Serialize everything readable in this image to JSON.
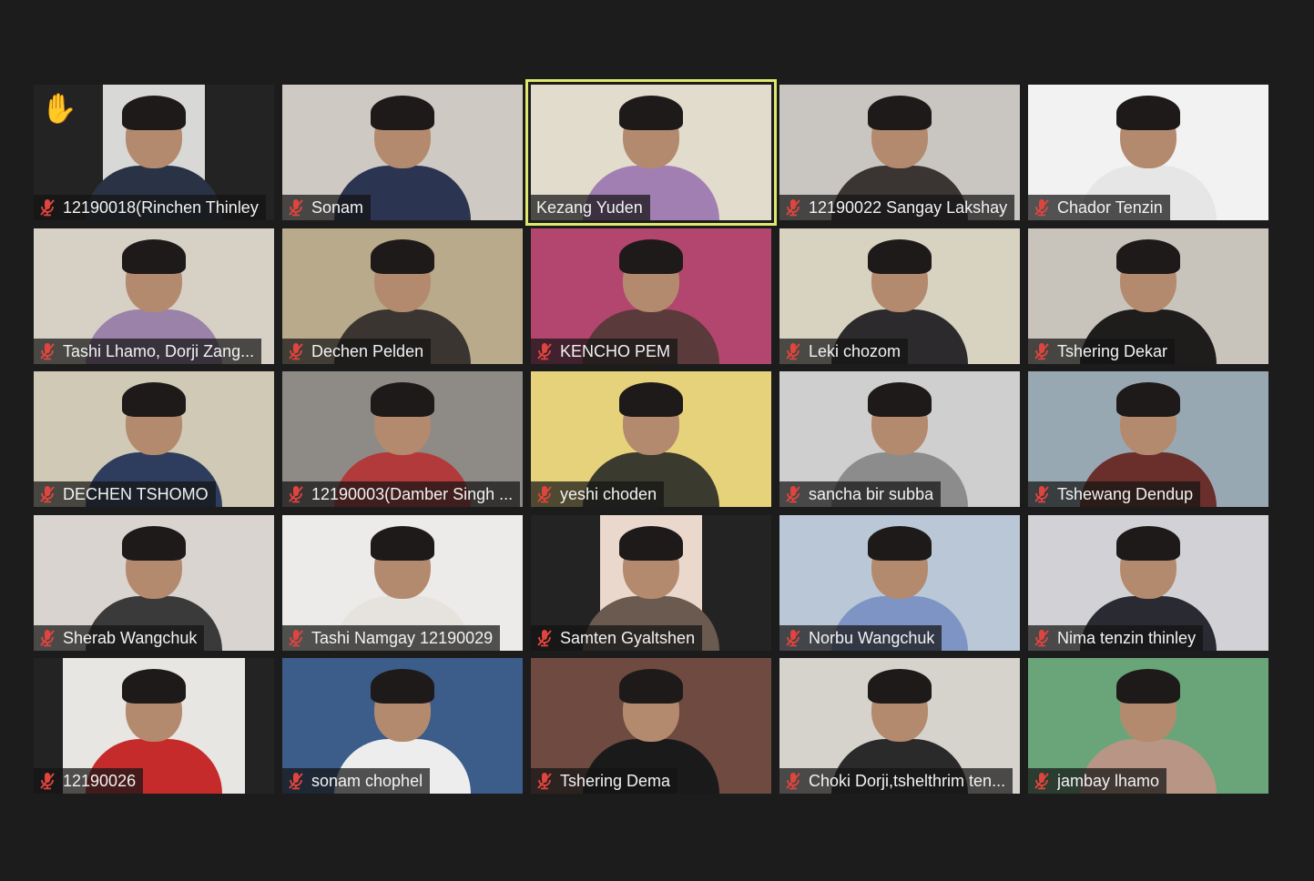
{
  "meeting": {
    "participants": [
      {
        "name": "12190018(Rinchen Thinley",
        "muted": true,
        "raised_hand": true,
        "bg": "#d8d8d6",
        "body": "#2a3346",
        "video": "narrow"
      },
      {
        "name": "Sonam",
        "muted": true,
        "bg": "#cfc9c4",
        "body": "#2b3552"
      },
      {
        "name": "Kezang Yuden",
        "muted": false,
        "active_speaker": true,
        "bg": "#e2dccd",
        "body": "#a27fb2"
      },
      {
        "name": "12190022 Sangay Lakshay",
        "muted": true,
        "bg": "#c9c6c2",
        "body": "#3a3432"
      },
      {
        "name": "Chador Tenzin",
        "muted": true,
        "bg": "#f2f2f2",
        "body": "#e6e6e6"
      },
      {
        "name": "Tashi Lhamo, Dorji Zang...",
        "muted": true,
        "bg": "#d6d0c5",
        "body": "#9a82a8"
      },
      {
        "name": "Dechen Pelden",
        "muted": true,
        "bg": "#b9aa8c",
        "body": "#3a3530"
      },
      {
        "name": "KENCHO PEM",
        "muted": true,
        "bg": "#b3466f",
        "body": "#5a3a3a"
      },
      {
        "name": "Leki chozom",
        "muted": true,
        "bg": "#d8d2c0",
        "body": "#2c2a2c"
      },
      {
        "name": "Tshering Dekar",
        "muted": true,
        "bg": "#c9c4bb",
        "body": "#1f1c1c"
      },
      {
        "name": "DECHEN TSHOMO",
        "muted": true,
        "bg": "#cfc9b5",
        "body": "#2e3d5e"
      },
      {
        "name": "12190003(Damber Singh ...",
        "muted": true,
        "bg": "#8e8a86",
        "body": "#b23a3a"
      },
      {
        "name": "yeshi choden",
        "muted": true,
        "bg": "#e6d27a",
        "body": "#3a3a2e"
      },
      {
        "name": "sancha bir subba",
        "muted": true,
        "bg": "#cfcfcf",
        "body": "#8c8c8c"
      },
      {
        "name": "Tshewang Dendup",
        "muted": true,
        "bg": "#98a8b3",
        "body": "#6a2f2a"
      },
      {
        "name": "Sherab Wangchuk",
        "muted": true,
        "bg": "#d9d4cf",
        "body": "#3a3a3a"
      },
      {
        "name": "Tashi Namgay 12190029",
        "muted": true,
        "bg": "#ecebea",
        "body": "#e6e3de"
      },
      {
        "name": "Samten Gyaltshen",
        "muted": true,
        "bg": "#ead8cc",
        "body": "#6a5a50",
        "video": "narrow"
      },
      {
        "name": "Norbu Wangchuk",
        "muted": true,
        "bg": "#b9c7d6",
        "body": "#7d94c4"
      },
      {
        "name": "Nima tenzin thinley",
        "muted": true,
        "bg": "#d2d2d6",
        "body": "#2a2a33"
      },
      {
        "name": "12190026",
        "muted": true,
        "bg": "#e8e6e2",
        "body": "#c62b2b",
        "video": "mid"
      },
      {
        "name": "sonam chophel",
        "muted": true,
        "bg": "#3c5c8a",
        "body": "#ededed"
      },
      {
        "name": "Tshering Dema",
        "muted": true,
        "bg": "#6e4a40",
        "body": "#1a1a1a"
      },
      {
        "name": "Choki Dorji,tshelthrim ten...",
        "muted": true,
        "bg": "#d6d3cc",
        "body": "#2a2a2a"
      },
      {
        "name": "jambay lhamo",
        "muted": true,
        "bg": "#6aa57a",
        "body": "#b89584"
      }
    ],
    "icons": {
      "muted_mic": "mic-muted-icon",
      "raised_hand": "raised-hand-icon",
      "hand_glyph": "✋"
    },
    "colors": {
      "muted_red": "#e0443e",
      "active_speaker_border": "#dfe86d",
      "background": "#1c1c1c"
    }
  }
}
